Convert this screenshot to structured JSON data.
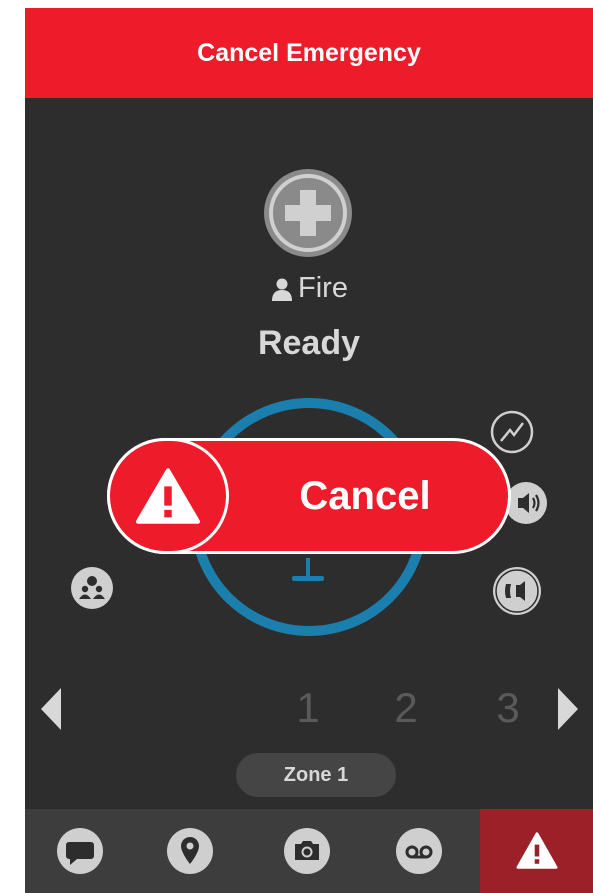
{
  "header": {
    "title": "Cancel Emergency"
  },
  "channel": {
    "user_label": "Fire",
    "status": "Ready",
    "icon": "medical-cross-icon"
  },
  "emergency_overlay": {
    "button_label": "Cancel",
    "icon": "warning-triangle-icon"
  },
  "side_controls": [
    {
      "name": "signal-icon"
    },
    {
      "name": "speaker-icon"
    },
    {
      "name": "earpiece-icon"
    },
    {
      "name": "group-location-icon"
    }
  ],
  "zone": {
    "pages": [
      "1",
      "2",
      "3"
    ],
    "current": "Zone 1"
  },
  "bottom_tabs": [
    {
      "name": "messages-icon"
    },
    {
      "name": "location-icon"
    },
    {
      "name": "camera-icon"
    },
    {
      "name": "voicemail-icon"
    },
    {
      "name": "emergency-icon"
    }
  ],
  "colors": {
    "accent_red": "#ee1c2b",
    "dark_red": "#9b2027",
    "ring_blue": "#1b7fad",
    "background": "#2d2d2d"
  }
}
